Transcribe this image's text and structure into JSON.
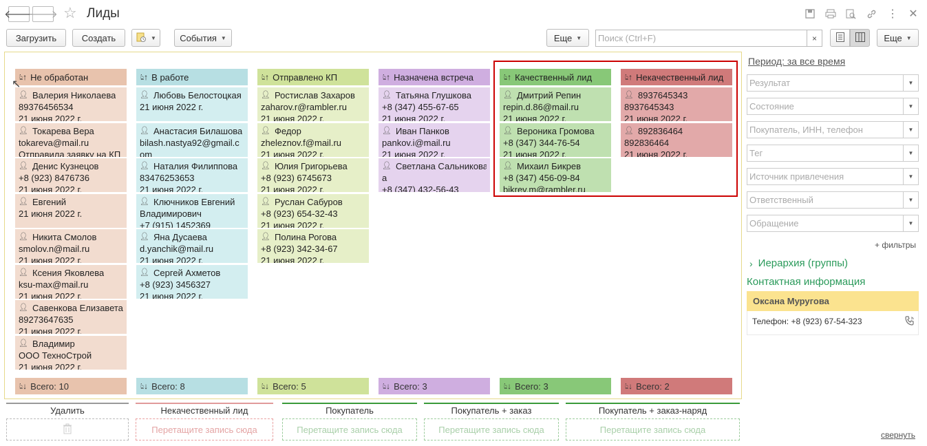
{
  "window": {
    "title": "Лиды"
  },
  "toolbar": {
    "upload": "Загрузить",
    "create": "Создать",
    "events": "События",
    "more1": "Еще",
    "more2": "Еще",
    "search_placeholder": "Поиск (Ctrl+F)",
    "clear": "×"
  },
  "columns": [
    {
      "title": "Не обработан",
      "head": "#e8c3ad",
      "card": "#f2dccf",
      "total": "Всего: 10",
      "cards": [
        [
          "Валерия Николаева",
          "89376456534",
          "21 июня 2022 г."
        ],
        [
          "Токарева Вера",
          "tokareva@mail.ru",
          "Отправила заявку на КП"
        ],
        [
          "Денис Кузнецов",
          "+8 (923) 8476736",
          "21 июня 2022 г."
        ],
        [
          "Евгений",
          "21 июня 2022 г.",
          ""
        ],
        [
          "Никита Смолов",
          "smolov.n@mail.ru",
          "21 июня 2022 г."
        ],
        [
          "Ксения Яковлева",
          "ksu-max@mail.ru",
          "21 июня 2022 г."
        ],
        [
          "Савенкова Елизавета",
          "89273647635",
          "21 июня 2022 г."
        ],
        [
          "Владимир",
          "ООО ТехноСтрой",
          "21 июня 2022 г."
        ]
      ]
    },
    {
      "title": "В работе",
      "head": "#b7dfe3",
      "card": "#d3eef0",
      "total": "Всего: 8",
      "cards": [
        [
          "Любовь Белостоцкая",
          "21 июня 2022 г.",
          ""
        ],
        [
          "Анастасия Билашова",
          "bilash.nastya92@gmail.c",
          "om"
        ],
        [
          "Наталия Филиппова",
          "83476253653",
          "21 июня 2022 г."
        ],
        [
          "Ключников Евгений",
          "Владимирович",
          "+7 (915) 1452369"
        ],
        [
          "Яна Дусаева",
          "d.yanchik@mail.ru",
          "21 июня 2022 г."
        ],
        [
          "Сергей Ахметов",
          "+8 (923) 3456327",
          "21 июня 2022 г."
        ]
      ]
    },
    {
      "title": "Отправлено КП",
      "head": "#cfe29a",
      "card": "#e6efc8",
      "total": "Всего: 5",
      "cards": [
        [
          "Ростислав Захаров",
          "zaharov.r@rambler.ru",
          "21 июня 2022 г."
        ],
        [
          "Федор",
          "zheleznov.f@mail.ru",
          "21 июня 2022 г."
        ],
        [
          "Юлия Григорьева",
          "+8 (923) 6745673",
          "21 июня 2022 г."
        ],
        [
          "Руслан Сабуров",
          "+8 (923) 654-32-43",
          "21 июня 2022 г."
        ],
        [
          "Полина Рогова",
          "+8 (923) 342-34-67",
          "21 июня 2022 г."
        ]
      ]
    },
    {
      "title": "Назначена встреча",
      "head": "#cfaee0",
      "card": "#e5d3ee",
      "total": "Всего: 3",
      "cards": [
        [
          "Татьяна Глушкова",
          "+8 (347) 455-67-65",
          "21 июня 2022 г."
        ],
        [
          "Иван Панков",
          "pankov.i@mail.ru",
          "21 июня 2022 г."
        ],
        [
          "Светлана Сальникова",
          "а",
          "+8 (347) 432-56-43"
        ]
      ]
    },
    {
      "title": "Качественный лид",
      "head": "#88c878",
      "card": "#bfe0b0",
      "total": "Всего: 3",
      "cards": [
        [
          "Дмитрий Репин",
          "repin.d.86@mail.ru",
          "21 июня 2022 г."
        ],
        [
          "Вероника Громова",
          "+8 (347) 344-76-54",
          "21 июня 2022 г."
        ],
        [
          "Михаил Бикрев",
          "+8 (347) 456-09-84",
          "bikrev.m@rambler.ru"
        ]
      ]
    },
    {
      "title": "Некачественный лид",
      "head": "#d07a7a",
      "card": "#e2a9a9",
      "total": "Всего: 2",
      "cards": [
        [
          "8937645343",
          "8937645343",
          "21 июня 2022 г."
        ],
        [
          "892836464",
          "892836464",
          "21 июня 2022 г."
        ]
      ]
    }
  ],
  "drops": [
    {
      "title": "Удалить",
      "line": "#999",
      "border": "#bbb",
      "text": "",
      "tcolor": "#ccc"
    },
    {
      "title": "Некачественный лид",
      "line": "#e09a9a",
      "border": "#e9a0a0",
      "text": "Перетащите запись сюда",
      "tcolor": "#e4a4a4"
    },
    {
      "title": "Покупатель",
      "line": "#3a9a3a",
      "border": "#9ccc9c",
      "text": "Перетащите запись сюда",
      "tcolor": "#a9cfa9"
    },
    {
      "title": "Покупатель + заказ",
      "line": "#3a9a3a",
      "border": "#9ccc9c",
      "text": "Перетащите запись сюда",
      "tcolor": "#a9cfa9"
    },
    {
      "title": "Покупатель + заказ-наряд",
      "line": "#3a9a3a",
      "border": "#9ccc9c",
      "text": "Перетащите запись сюда",
      "tcolor": "#a9cfa9"
    }
  ],
  "sidebar": {
    "period": "Период: за все время",
    "filters": [
      "Результат",
      "Состояние",
      "Покупатель, ИНН, телефон",
      "Тег",
      "Источник привлечения",
      "Ответственный",
      "Обращение"
    ],
    "more_filters": "+ фильтры",
    "hierarchy": "Иерархия (группы)",
    "contact_title": "Контактная информация",
    "contact_name": "Оксана Муругова",
    "contact_phone": "Телефон: +8 (923) 67-54-323",
    "collapse": "свернуть"
  }
}
